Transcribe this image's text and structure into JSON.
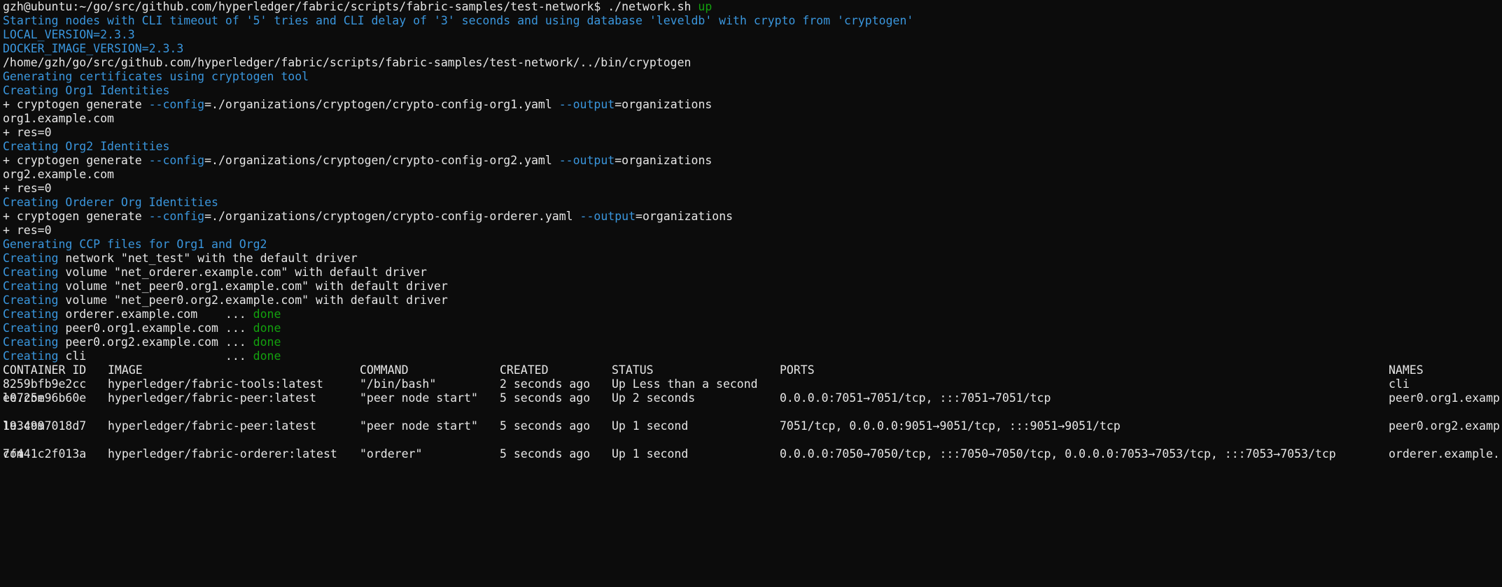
{
  "terminal": {
    "prompt": "gzh@ubuntu:~/go/src/github.com/hyperledger/fabric/scripts/fabric-samples/test-network$ ",
    "command": "./network.sh ",
    "command_arg": "up",
    "lines": {
      "l1": "Starting nodes with CLI timeout of '5' tries and CLI delay of '3' seconds and using database 'leveldb' with crypto from 'cryptogen'",
      "l2": "LOCAL_VERSION=2.3.3",
      "l3": "DOCKER_IMAGE_VERSION=2.3.3",
      "l4": "/home/gzh/go/src/github.com/hyperledger/fabric/scripts/fabric-samples/test-network/../bin/cryptogen",
      "l5": "Generating certificates using cryptogen tool",
      "l6": "Creating Org1 Identities",
      "l7a": "+ cryptogen generate ",
      "l7b": "--config",
      "l7c": "=./organizations/cryptogen/crypto-config-org1.yaml ",
      "l7d": "--output",
      "l7e": "=organizations",
      "l8": "org1.example.com",
      "l9": "+ res=0",
      "l10": "Creating Org2 Identities",
      "l11a": "+ cryptogen generate ",
      "l11b": "--config",
      "l11c": "=./organizations/cryptogen/crypto-config-org2.yaml ",
      "l11d": "--output",
      "l11e": "=organizations",
      "l12": "org2.example.com",
      "l13": "+ res=0",
      "l14": "Creating Orderer Org Identities",
      "l15a": "+ cryptogen generate ",
      "l15b": "--config",
      "l15c": "=./organizations/cryptogen/crypto-config-orderer.yaml ",
      "l15d": "--output",
      "l15e": "=organizations",
      "l16": "+ res=0",
      "l17": "Generating CCP files for Org1 and Org2",
      "creating_word": "Creating",
      "l18": " network \"net_test\" with the default driver",
      "l19": " volume \"net_orderer.example.com\" with default driver",
      "l20": " volume \"net_peer0.org1.example.com\" with default driver",
      "l21": " volume \"net_peer0.org2.example.com\" with default driver",
      "l22": " orderer.example.com    ... ",
      "l23": " peer0.org1.example.com ... ",
      "l24": " peer0.org2.example.com ... ",
      "l25": " cli                    ... ",
      "done": "done"
    },
    "docker_ps": {
      "headers": {
        "id": "CONTAINER ID",
        "image": "IMAGE",
        "command": "COMMAND",
        "created": "CREATED",
        "status": "STATUS",
        "ports": "PORTS",
        "names": "NAMES"
      },
      "rows": [
        {
          "id": "8259bfb9e2cc",
          "image": "hyperledger/fabric-tools:latest",
          "command": "\"/bin/bash\"",
          "created": "2 seconds ago",
          "status": "Up Less than a second",
          "ports": "",
          "names": "cli",
          "wrap": ""
        },
        {
          "id": "e0725e96b60e",
          "image": "hyperledger/fabric-peer:latest",
          "command": "\"peer node start\"",
          "created": "5 seconds ago",
          "status": "Up 2 seconds",
          "ports": "0.0.0.0:7051→7051/tcp, :::7051→7051/tcp",
          "names": "peer0.org1.examp",
          "wrap": "le.com"
        },
        {
          "id": "1934997018d7",
          "image": "hyperledger/fabric-peer:latest",
          "command": "\"peer node start\"",
          "created": "5 seconds ago",
          "status": "Up 1 second",
          "ports": "7051/tcp, 0.0.0.0:9051→9051/tcp, :::9051→9051/tcp",
          "names": "peer0.org2.examp",
          "wrap": "le.com"
        },
        {
          "id": "7f441c2f013a",
          "image": "hyperledger/fabric-orderer:latest",
          "command": "\"orderer\"",
          "created": "5 seconds ago",
          "status": "Up 1 second",
          "ports": "0.0.0.0:7050→7050/tcp, :::7050→7050/tcp, 0.0.0.0:7053→7053/tcp, :::7053→7053/tcp",
          "names": "orderer.example.",
          "wrap": "com"
        }
      ]
    },
    "colors": {
      "background": "#0c0c0c",
      "text": "#e6e6e6",
      "info": "#3a96dd",
      "success": "#13a10e"
    }
  }
}
